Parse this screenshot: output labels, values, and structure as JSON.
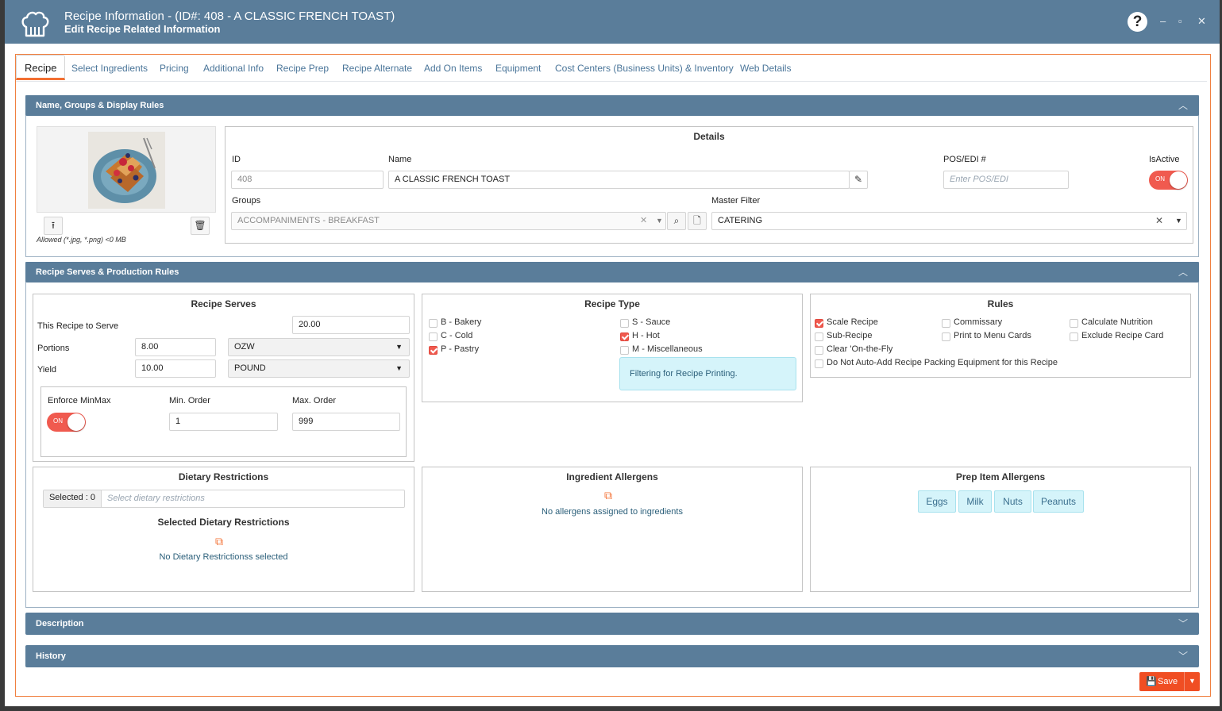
{
  "window": {
    "title": "Recipe Information - (ID#: 408 - A CLASSIC FRENCH TOAST)",
    "subtitle": "Edit Recipe Related Information",
    "help": "?",
    "minimize": "–",
    "maximize": "▫",
    "close": "✕"
  },
  "tabs": [
    "Recipe",
    "Select Ingredients",
    "Pricing",
    "Additional Info",
    "Recipe Prep",
    "Recipe Alternate",
    "Add On Items",
    "Equipment",
    "Cost Centers (Business Units) & Inventory",
    "Web Details"
  ],
  "sections": {
    "name_groups": "Name, Groups & Display Rules",
    "serves_production": "Recipe Serves & Production Rules",
    "description": "Description",
    "history": "History"
  },
  "image": {
    "allowed_text": "Allowed (*.jpg, *.png) <0 MB"
  },
  "details": {
    "title": "Details",
    "id_label": "ID",
    "id_value": "408",
    "name_label": "Name",
    "name_value": "A CLASSIC FRENCH TOAST",
    "pos_label": "POS/EDI #",
    "pos_placeholder": "Enter POS/EDI",
    "isactive_label": "IsActive",
    "toggle_on": "ON",
    "groups_label": "Groups",
    "groups_value": "ACCOMPANIMENTS - BREAKFAST",
    "master_filter_label": "Master Filter",
    "master_filter_value": "CATERING"
  },
  "serves": {
    "title": "Recipe Serves",
    "to_serve_label": "This Recipe to Serve",
    "to_serve_value": "20.00",
    "portions_label": "Portions",
    "portions_value": "8.00",
    "portions_unit": "OZW",
    "yield_label": "Yield",
    "yield_value": "10.00",
    "yield_unit": "POUND",
    "enforce_label": "Enforce MinMax",
    "min_label": "Min. Order",
    "min_value": "1",
    "max_label": "Max. Order",
    "max_value": "999",
    "toggle_on": "ON"
  },
  "recipe_type": {
    "title": "Recipe Type",
    "left": [
      {
        "label": "B - Bakery",
        "checked": false
      },
      {
        "label": "C - Cold",
        "checked": false
      },
      {
        "label": "P - Pastry",
        "checked": true
      }
    ],
    "right": [
      {
        "label": "S - Sauce",
        "checked": false
      },
      {
        "label": "H - Hot",
        "checked": true
      },
      {
        "label": "M - Miscellaneous",
        "checked": false
      }
    ],
    "info": "Filtering for Recipe Printing."
  },
  "rules": {
    "title": "Rules",
    "col1": [
      {
        "label": "Scale Recipe",
        "checked": true
      },
      {
        "label": "Sub-Recipe",
        "checked": false
      },
      {
        "label": "Clear 'On-the-Fly",
        "checked": false
      },
      {
        "label": "Do Not Auto-Add Recipe Packing Equipment for this Recipe",
        "checked": false
      }
    ],
    "col2": [
      {
        "label": "Commissary",
        "checked": false
      },
      {
        "label": "Print to Menu Cards",
        "checked": false
      }
    ],
    "col3": [
      {
        "label": "Calculate Nutrition",
        "checked": false
      },
      {
        "label": "Exclude Recipe Card",
        "checked": false
      }
    ]
  },
  "dietary": {
    "title": "Dietary Restrictions",
    "selected_count": "Selected : 0",
    "placeholder": "Select dietary restrictions",
    "selected_title": "Selected Dietary Restrictions",
    "empty": "No Dietary Restrictionss selected"
  },
  "ingredient_allergens": {
    "title": "Ingredient Allergens",
    "empty": "No allergens assigned to ingredients"
  },
  "prep_allergens": {
    "title": "Prep Item Allergens",
    "chips": [
      "Eggs",
      "Milk",
      "Nuts",
      "Peanuts"
    ]
  },
  "save": {
    "label": "Save"
  },
  "colors": {
    "header": "#5a7d9a",
    "accent": "#f36f31",
    "toggle": "#f05a4f",
    "link": "#4a7599"
  }
}
